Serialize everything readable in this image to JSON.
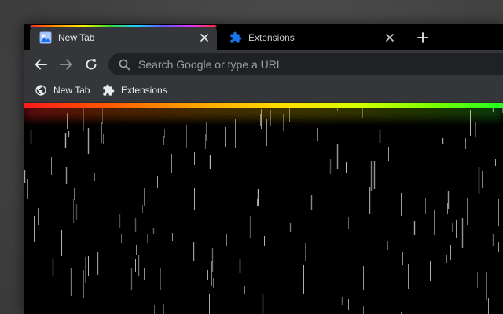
{
  "tabs": [
    {
      "label": "New Tab",
      "icon": "image-icon",
      "active": true
    },
    {
      "label": "Extensions",
      "icon": "puzzle-icon",
      "active": false
    }
  ],
  "tabstrip": {
    "new_tab_icon": "plus-icon"
  },
  "toolbar": {
    "back_icon": "arrow-left-icon",
    "forward_icon": "arrow-right-icon",
    "reload_icon": "reload-icon",
    "omnibox": {
      "placeholder": "Search Google or type a URL",
      "icon": "search-icon"
    }
  },
  "bookmarks": [
    {
      "label": "New Tab",
      "icon": "globe-icon"
    },
    {
      "label": "Extensions",
      "icon": "puzzle-icon"
    }
  ],
  "theme": {
    "frame": "#000000",
    "toolbar": "#35363a",
    "omnibox_bg": "#202124",
    "text": "#e8eaed",
    "muted_text": "#9aa0a6",
    "extension_accent": "#1a73e8",
    "rain": "#cfcfcf"
  }
}
